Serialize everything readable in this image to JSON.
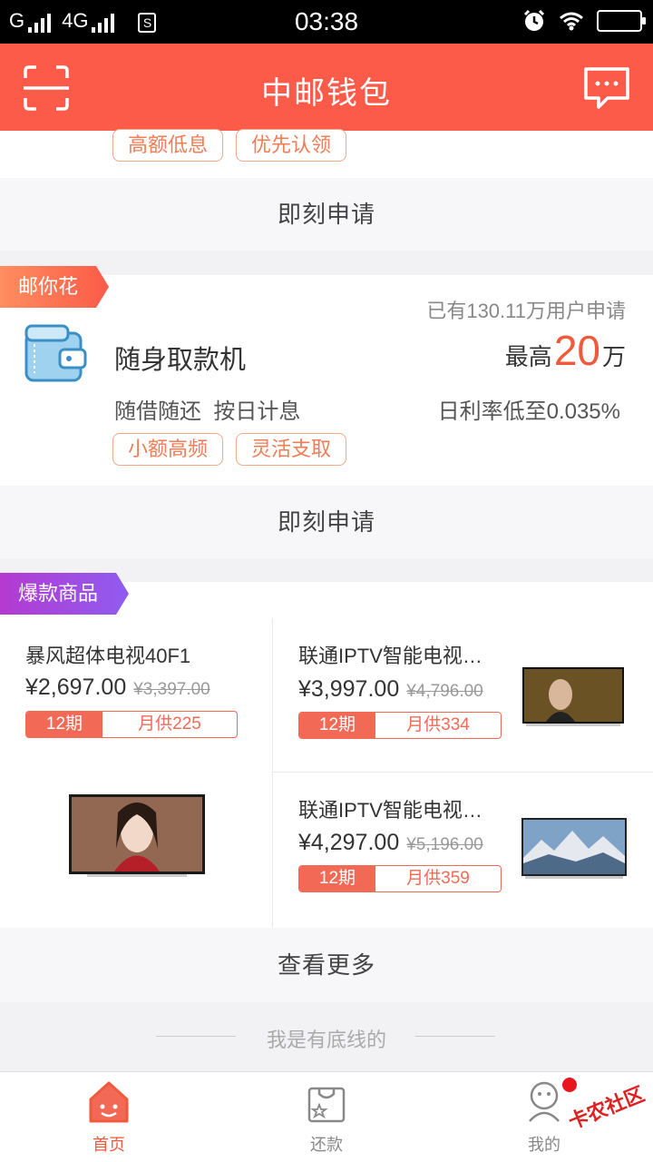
{
  "status_bar": {
    "carrier": "G",
    "network": "4G",
    "sim_badge": "S",
    "time": "03:38"
  },
  "header": {
    "title": "中邮钱包"
  },
  "card1": {
    "tags": [
      "高额低息",
      "优先认领"
    ],
    "apply_label": "即刻申请"
  },
  "card2": {
    "ribbon": "邮你花",
    "applicants": "已有130.11万用户申请",
    "product_name": "随身取款机",
    "max_prefix": "最高",
    "max_amount": "20",
    "max_unit": "万",
    "desc": "随借随还  按日计息",
    "rate": "日利率低至0.035%",
    "tags": [
      "小额高频",
      "灵活支取"
    ],
    "apply_label": "即刻申请"
  },
  "hot_products": {
    "ribbon": "爆款商品",
    "items": [
      {
        "name": "暴风超体电视40F1",
        "price": "¥2,697.00",
        "old_price": "¥3,397.00",
        "periods": "12期",
        "monthly": "月供225"
      },
      {
        "name": "联通IPTV智能电视…",
        "price": "¥3,997.00",
        "old_price": "¥4,796.00",
        "periods": "12期",
        "monthly": "月供334"
      },
      {
        "name": "联通IPTV智能电视…",
        "price": "¥4,297.00",
        "old_price": "¥5,196.00",
        "periods": "12期",
        "monthly": "月供359"
      }
    ],
    "more_label": "查看更多"
  },
  "footer_note": "我是有底线的",
  "tabbar": {
    "tabs": [
      {
        "label": "首页"
      },
      {
        "label": "还款"
      },
      {
        "label": "我的"
      }
    ]
  },
  "watermark": "卡农社区",
  "colors": {
    "brand": "#fb5b48",
    "accent_red": "#f26a55",
    "tag_border": "#f2a98a"
  }
}
